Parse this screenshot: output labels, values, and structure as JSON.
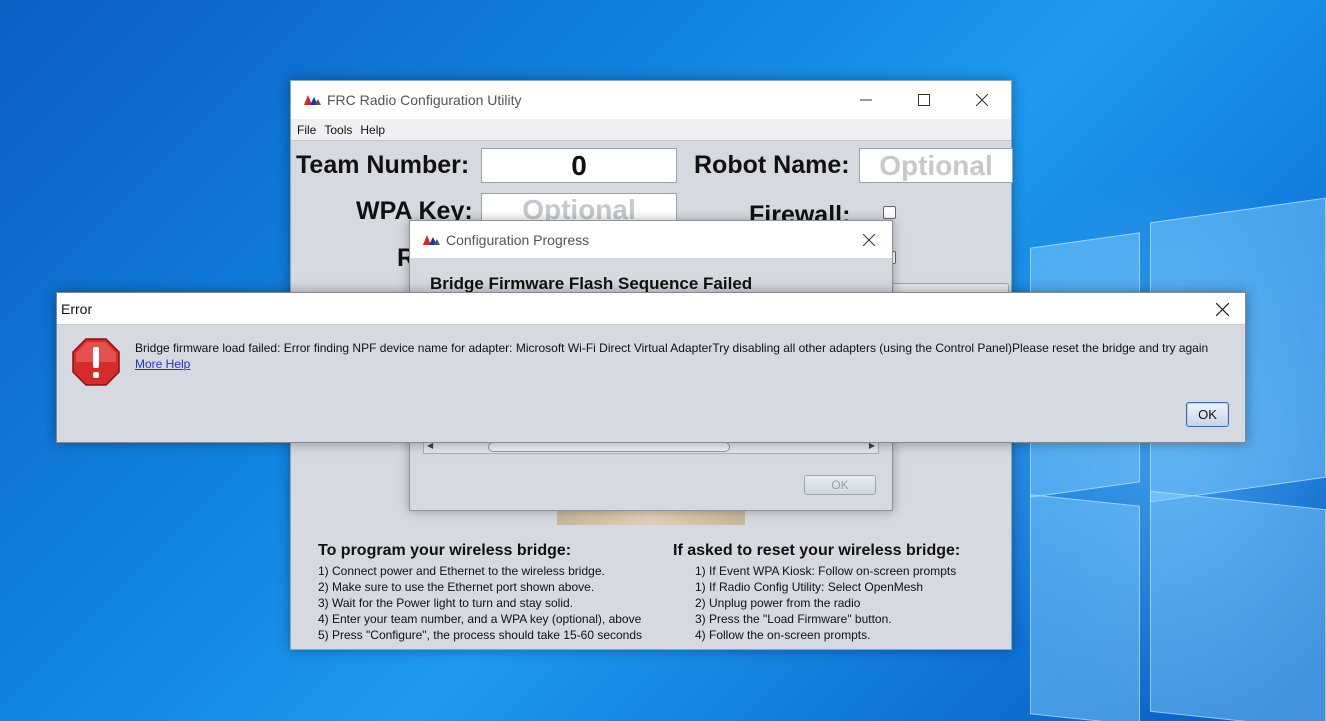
{
  "main_window": {
    "title": "FRC Radio Configuration Utility",
    "menu": [
      "File",
      "Tools",
      "Help"
    ],
    "team_number_label": "Team Number:",
    "team_number_value": "0",
    "robot_name_label": "Robot Name:",
    "robot_name_placeholder": "Optional",
    "wpa_key_label": "WPA Key:",
    "wpa_key_placeholder": "Optional",
    "firewall_label": "Firewall:",
    "partial_label_r": "R",
    "program_heading": "To program your wireless bridge:",
    "program_steps": [
      "1) Connect power and Ethernet to the wireless bridge.",
      "2) Make sure to use the Ethernet port shown above.",
      "3) Wait for the Power light to turn and stay solid.",
      "4) Enter your team number, and a WPA key (optional), above",
      "5) Press \"Configure\", the process should take 15-60 seconds"
    ],
    "reset_heading": "If asked to reset your wireless bridge:",
    "reset_steps": [
      "1) If Event WPA Kiosk: Follow on-screen prompts",
      "1) If Radio Config Utility: Select OpenMesh",
      "2) Unplug power from the radio",
      "3) Press the \"Load Firmware\" button.",
      "4) Follow the on-screen prompts."
    ]
  },
  "progress_dialog": {
    "title": "Configuration Progress",
    "heading": "Bridge Firmware Flash Sequence Failed",
    "ok_label": "OK"
  },
  "error_dialog": {
    "title": "Error",
    "message": "Bridge firmware load failed: Error finding NPF device name for adapter: Microsoft Wi-Fi Direct Virtual AdapterTry disabling all other adapters (using the Control Panel)Please reset the bridge and try again",
    "link": "More Help",
    "ok_label": "OK"
  },
  "icons": {
    "app_logo": "frc-logo-icon",
    "error": "error-octagon-icon"
  },
  "colors": {
    "error_red": "#d62b2b",
    "link_blue": "#2533c9"
  }
}
